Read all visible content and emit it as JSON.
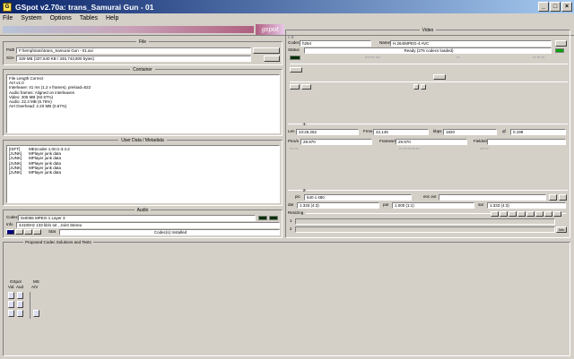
{
  "window": {
    "title": "GSpot v2.70a: trans_Samurai Gun - 01"
  },
  "menu": [
    "File",
    "System",
    "Options",
    "Tables",
    "Help"
  ],
  "logo": "gspot",
  "file": {
    "title": "File",
    "path_label": "Path",
    "path": "F:\\temp\\trans\\trans_Samurai Gun - 01.avi",
    "size_label": "Size",
    "size": "329 MB (337,640 KB / 345,743,800 bytes)"
  },
  "container": {
    "title": "Container",
    "lines": [
      "File Length Correct",
      "AVI v1.0",
      "Interleave: 41 ms (1.2 v frames), preload=522",
      "Audio frames: Aligned on interleaves",
      "Video: 305 MB (92.57%)",
      "Audio: 22.3 MB (6.76%)",
      "AVI Overhead: 2.20 MB (0.67%)"
    ]
  },
  "userdata": {
    "title": "User Data / Metadata",
    "rows": [
      [
        "[ISFT]",
        "MEncoder 1.0rc1-3.4.2"
      ],
      [
        "[JUNK]",
        "MPlayer junk data"
      ],
      [
        "[JUNK]",
        "MPlayer junk data"
      ],
      [
        "[JUNK]",
        "MPlayer junk data"
      ],
      [
        "[JUNK]",
        "MPlayer junk data"
      ],
      [
        "[JUNK]",
        "MPlayer junk data"
      ]
    ]
  },
  "audio": {
    "title": "Audio",
    "codec_label": "Codec",
    "codec": "0x0055 MPEG-1 Layer 3",
    "info_label": "Info",
    "info": "44100Hz  133 kb/s tot , Joint Stereo",
    "stat_label": "Stat",
    "status": "Codec(s) Installed"
  },
  "video": {
    "title": "Video",
    "codec_label": "Codec",
    "codec": "h264",
    "name_label": "Name",
    "name": "H.264/MPEG-4 AVC",
    "status_label": "Status",
    "status": "Ready (276 codecs loaded)",
    "section1": "1",
    "len_label": "Len",
    "len": "23:26.262",
    "frms_label": "Frms",
    "frms": "42,145",
    "kbps_label": "kbps",
    "kbps": "1820",
    "qf_label": "qf",
    "qf": "0.198",
    "pics_label": "Pics/s",
    "pics": "29.970",
    "frames_label": "Frames/s",
    "frames": "29.970",
    "fields_label": "Fields/s",
    "fields": "",
    "section2": "2",
    "pic_label": "pic",
    "pic": "640 x 480",
    "enc_label": "enc ext",
    "enc": "",
    "dar_label": "dar",
    "dar": "1.333 (4:3)",
    "par_label": "par",
    "par": "1.000 (1:1)",
    "sar_label": "sar",
    "sar": "1.333 (4:3)",
    "resizing_label": "Resizing",
    "row1": "1",
    "row2": "2",
    "info_btn": "Info"
  },
  "proposed": {
    "title": "Proposed Codec Solutions and Tests",
    "gspot_label": "GSpot",
    "vid_label": "Vid",
    "aud_label": "Aud",
    "ms_label": "MS",
    "av_label": "A/V"
  }
}
